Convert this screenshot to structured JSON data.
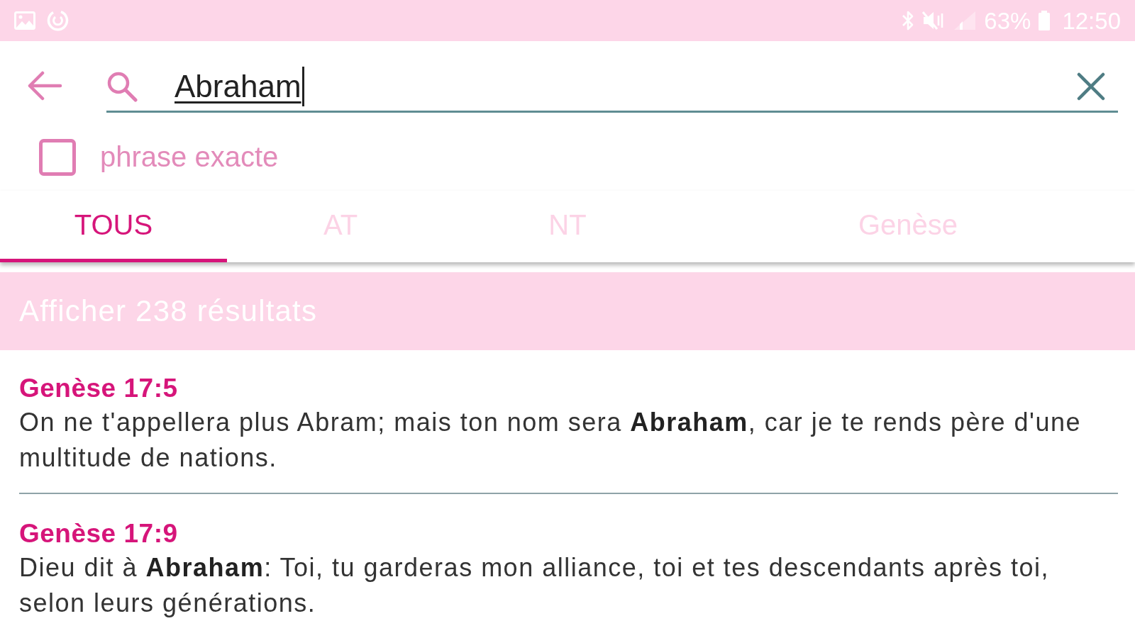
{
  "status_bar": {
    "battery": "63%",
    "time": "12:50"
  },
  "search": {
    "value": "Abraham"
  },
  "exact_phrase": {
    "label": "phrase exacte",
    "checked": false
  },
  "tabs": [
    {
      "label": "TOUS",
      "selected": true
    },
    {
      "label": "AT",
      "selected": false
    },
    {
      "label": "NT",
      "selected": false
    },
    {
      "label": "Genèse",
      "selected": false
    }
  ],
  "results_banner": {
    "label": "Afficher 238 résultats"
  },
  "results": [
    {
      "reference": "Genèse 17:5",
      "text": "On ne t'appellera plus Abram; mais ton nom sera **Abraham**, car je te rends père d'une multitude de nations."
    },
    {
      "reference": "Genèse 17:9",
      "text": "Dieu dit à **Abraham**: Toi, tu garderas mon alliance, toi et tes descendants après toi, selon leurs générations."
    }
  ]
}
